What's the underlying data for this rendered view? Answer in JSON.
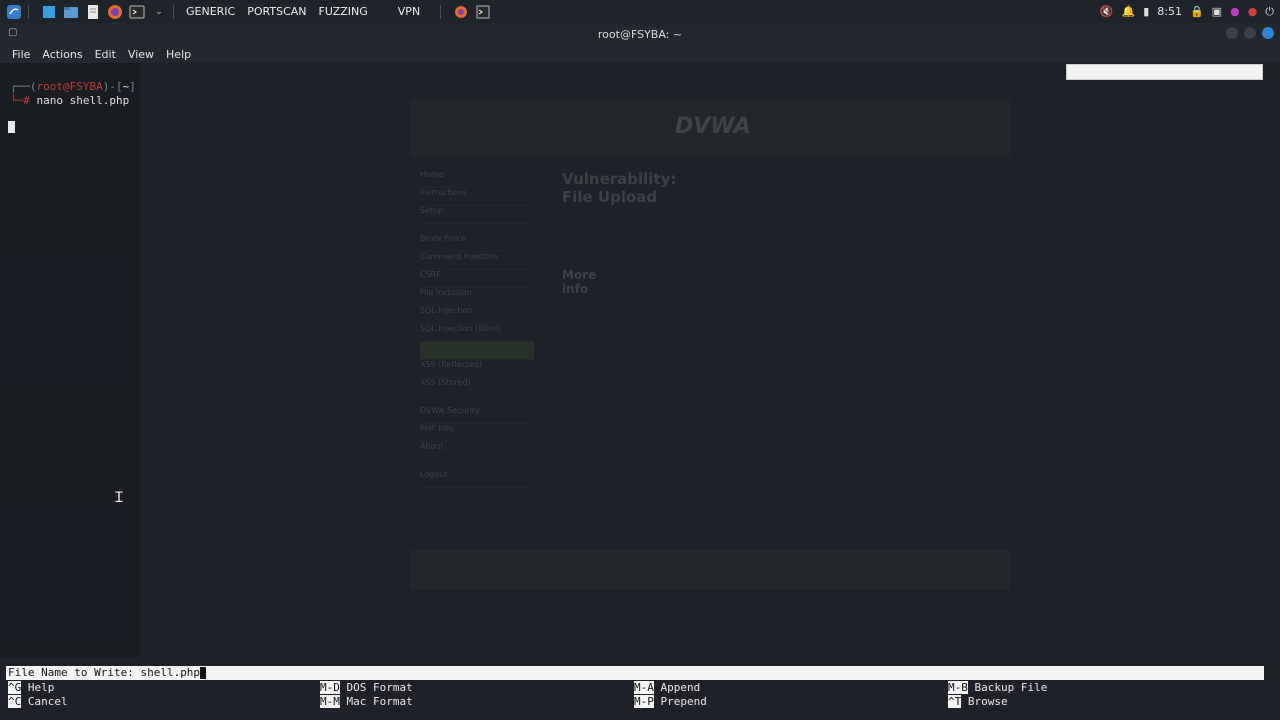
{
  "panel": {
    "workspaces": [
      "GENERIC",
      "PORTSCAN",
      "FUZZING",
      "VPN"
    ],
    "clock": "8:51"
  },
  "window": {
    "title": "root@FSYBA: ~",
    "menu": [
      "File",
      "Actions",
      "Edit",
      "View",
      "Help"
    ]
  },
  "terminal": {
    "prompt_user": "root@FSYBA",
    "prompt_dir": "~",
    "prompt_prefix": "┌──(",
    "prompt_mid": ")-[",
    "prompt_end": "]",
    "prompt_arrow": "└─#",
    "command": "nano shell.php"
  },
  "background_page": {
    "logo": "DVWA",
    "heading": "Vulnerability: File Upload",
    "more_info": "More info",
    "nav": [
      "Home",
      "Instructions",
      "Setup",
      "Brute Force",
      "Command Injection",
      "CSRF",
      "File Inclusion",
      "SQL Injection",
      "SQL Injection (Blind)",
      "",
      "XSS (Reflected)",
      "XSS (Stored)",
      "DVWA Security",
      "PHP Info",
      "About",
      "Logout"
    ]
  },
  "nano": {
    "prompt_label": "File Name to Write: ",
    "prompt_value": "shell.php",
    "shortcuts": [
      {
        "key": "^G",
        "label": "Help"
      },
      {
        "key": "^C",
        "label": "Cancel"
      },
      {
        "key": "M-D",
        "label": "DOS Format"
      },
      {
        "key": "M-M",
        "label": "Mac Format"
      },
      {
        "key": "M-A",
        "label": "Append"
      },
      {
        "key": "M-P",
        "label": "Prepend"
      },
      {
        "key": "M-B",
        "label": "Backup File"
      },
      {
        "key": "^T",
        "label": "Browse"
      }
    ]
  }
}
